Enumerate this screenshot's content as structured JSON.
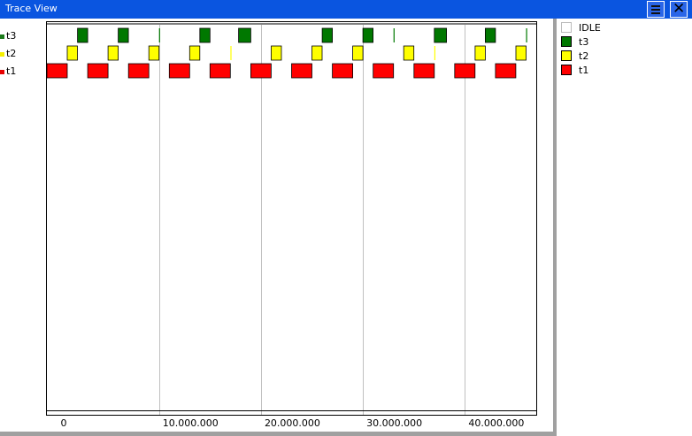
{
  "window": {
    "title": "Trace View"
  },
  "toolbar": {
    "menu_icon": "list-menu-icon",
    "close_icon": "close-icon",
    "close_glyph": "✕"
  },
  "tasks": [
    {
      "name": "t3",
      "color": "#1a7a1a"
    },
    {
      "name": "t2",
      "color": "#f5f000"
    },
    {
      "name": "t1",
      "color": "#e80000"
    }
  ],
  "legend": [
    {
      "label": "IDLE",
      "color": "#ffffff"
    },
    {
      "label": "t3",
      "color": "#007800"
    },
    {
      "label": "t2",
      "color": "#ffff00"
    },
    {
      "label": "t1",
      "color": "#ff0000"
    }
  ],
  "chart_data": {
    "type": "gantt",
    "x_range": [
      -1000000,
      47000000
    ],
    "x_ticks": [
      {
        "value": 0,
        "label": "0"
      },
      {
        "value": 10000000,
        "label": "10.000.000"
      },
      {
        "value": 20000000,
        "label": "20.000.000"
      },
      {
        "value": 30000000,
        "label": "30.000.000"
      },
      {
        "value": 40000000,
        "label": "40.000.000"
      }
    ],
    "gridlines": [
      10000000,
      20000000,
      30000000,
      40000000
    ],
    "series": [
      {
        "name": "t3",
        "color": "#007800",
        "intervals": [
          [
            2000000,
            3000000
          ],
          [
            6000000,
            7000000
          ],
          [
            10000000,
            10100000
          ],
          [
            14000000,
            15000000
          ],
          [
            17800000,
            19000000
          ],
          [
            26000000,
            27000000
          ],
          [
            30000000,
            31000000
          ],
          [
            33000000,
            33100000
          ],
          [
            37000000,
            38200000
          ],
          [
            42000000,
            43000000
          ],
          [
            46000000,
            46100000
          ]
        ]
      },
      {
        "name": "t2",
        "color": "#ffff00",
        "intervals": [
          [
            1000000,
            2000000
          ],
          [
            5000000,
            6000000
          ],
          [
            9000000,
            10000000
          ],
          [
            13000000,
            14000000
          ],
          [
            17000000,
            17100000
          ],
          [
            21000000,
            22000000
          ],
          [
            25000000,
            26000000
          ],
          [
            29000000,
            30000000
          ],
          [
            34000000,
            35000000
          ],
          [
            37000000,
            37100000
          ],
          [
            41000000,
            42000000
          ],
          [
            45000000,
            46000000
          ]
        ]
      },
      {
        "name": "t1",
        "color": "#ff0000",
        "intervals": [
          [
            -1000000,
            1000000
          ],
          [
            3000000,
            5000000
          ],
          [
            7000000,
            9000000
          ],
          [
            11000000,
            13000000
          ],
          [
            15000000,
            17000000
          ],
          [
            19000000,
            21000000
          ],
          [
            23000000,
            25000000
          ],
          [
            27000000,
            29000000
          ],
          [
            31000000,
            33000000
          ],
          [
            35000000,
            37000000
          ],
          [
            39000000,
            41000000
          ],
          [
            43000000,
            45000000
          ]
        ]
      }
    ]
  }
}
